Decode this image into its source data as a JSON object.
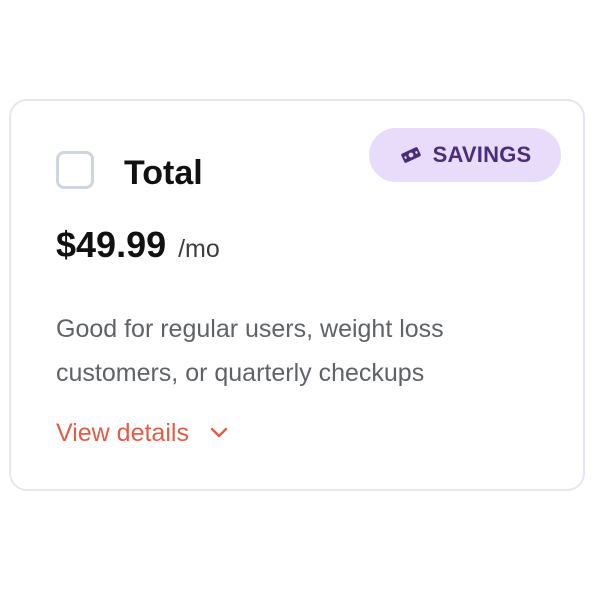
{
  "card": {
    "title": "Total",
    "price": "$49.99",
    "period": "/mo",
    "description": "Good for regular users, weight loss customers, or quarterly checkups",
    "details_link": "View details",
    "badge": {
      "label": "SAVINGS",
      "icon": "money-icon",
      "background": "#e9dcfb",
      "color": "#4b2d79"
    },
    "checkbox_checked": false,
    "accent_color": "#e35d46"
  }
}
